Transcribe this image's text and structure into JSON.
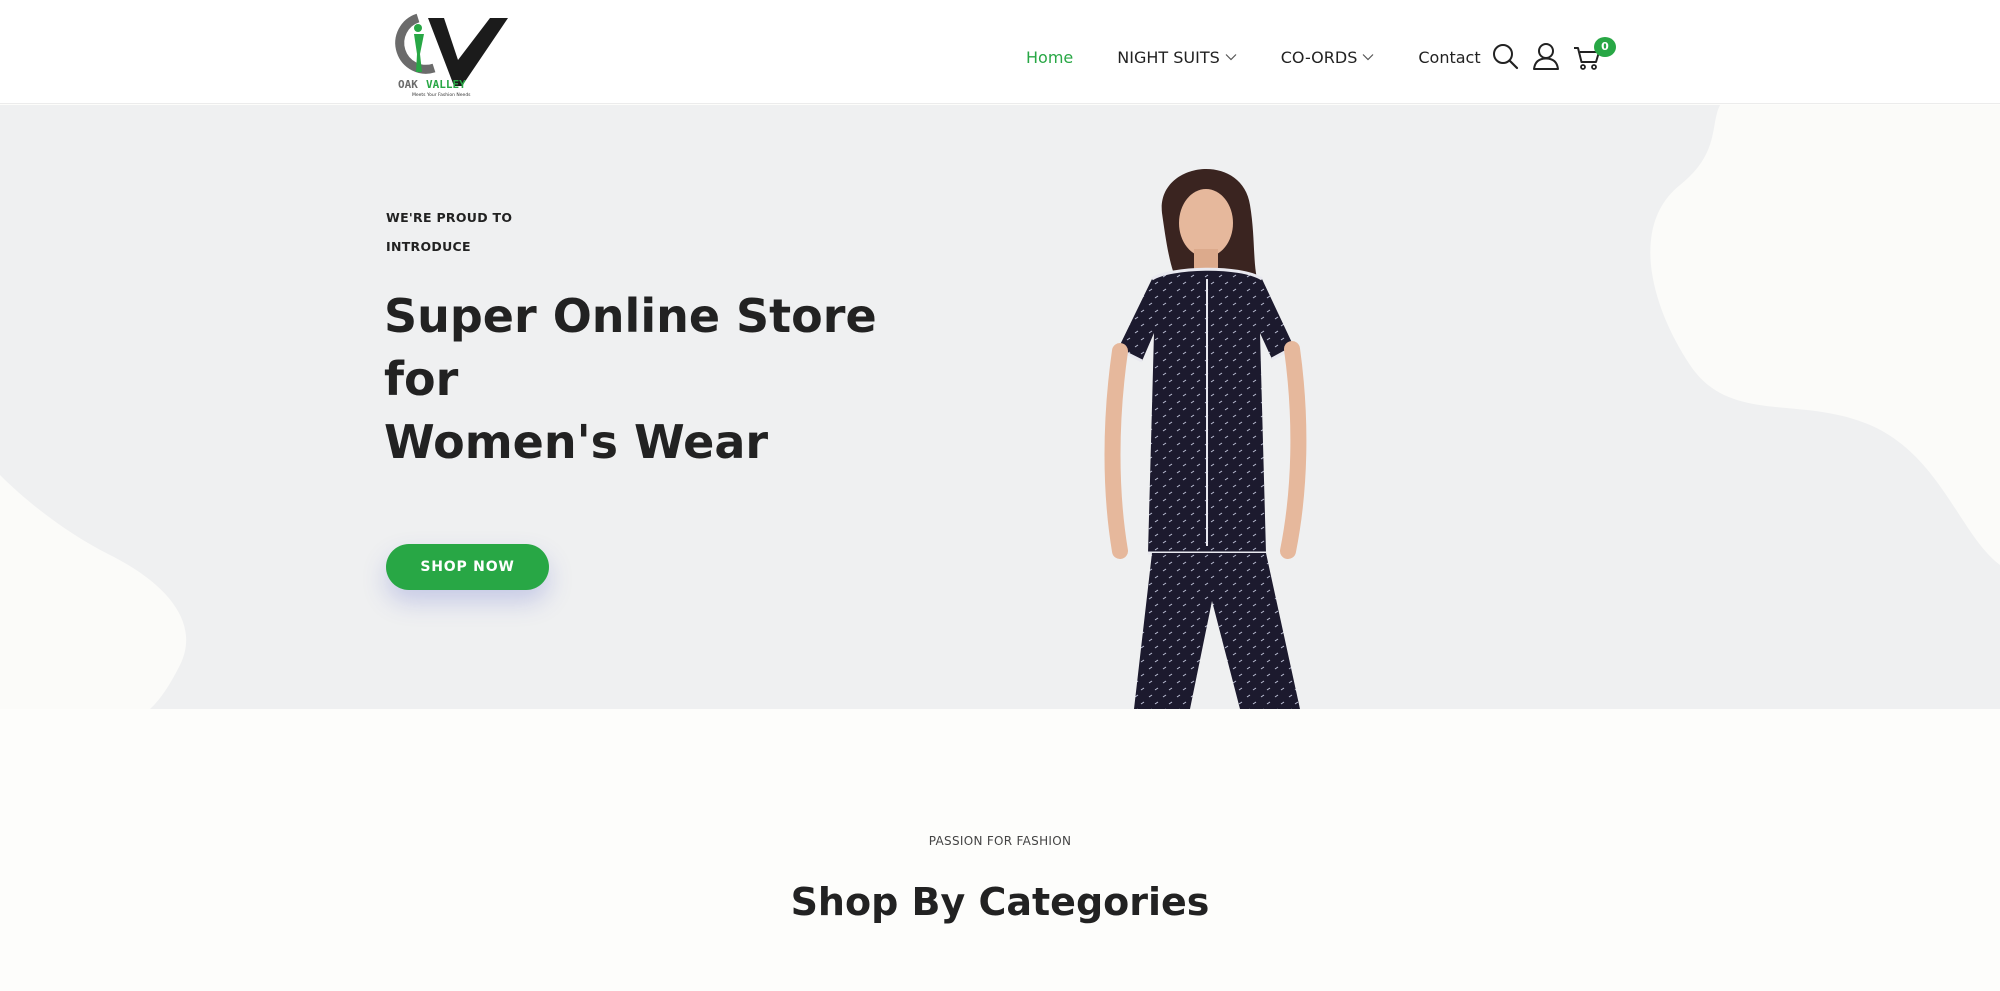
{
  "brand": {
    "name": "OAK VALLEY",
    "tagline": "Meets Your Fashion Needs",
    "colors": {
      "accent": "#28a745",
      "text": "#222222",
      "hero_bg": "#eff0f1"
    }
  },
  "nav": {
    "items": [
      {
        "label": "Home",
        "active": true,
        "has_dropdown": false
      },
      {
        "label": "NIGHT SUITS",
        "active": false,
        "has_dropdown": true
      },
      {
        "label": "CO-ORDS",
        "active": false,
        "has_dropdown": true
      },
      {
        "label": "Contact",
        "active": false,
        "has_dropdown": false
      }
    ],
    "icons": [
      "search-icon",
      "user-icon",
      "cart-icon"
    ],
    "cart_count": "0"
  },
  "hero": {
    "eyebrow_line1": "WE'RE PROUD TO",
    "eyebrow_line2": "INTRODUCE",
    "title_line1": "Super Online Store",
    "title_line2": "for",
    "title_line3": "Women's Wear",
    "cta_label": "SHOP NOW"
  },
  "categories": {
    "eyebrow": "PASSION FOR FASHION",
    "title": "Shop By Categories"
  }
}
